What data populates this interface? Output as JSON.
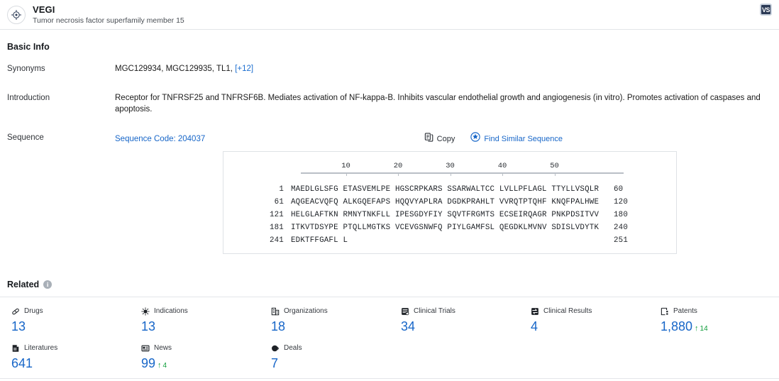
{
  "header": {
    "title": "VEGI",
    "subtitle": "Tumor necrosis factor superfamily member 15",
    "badge_label": "VS",
    "target_icon": "target-icon"
  },
  "basic_info": {
    "section_title": "Basic Info",
    "synonyms": {
      "label": "Synonyms",
      "value": "MGC129934, MGC129935, TL1,",
      "more": "[+12]"
    },
    "introduction": {
      "label": "Introduction",
      "value": "Receptor for TNFRSF25 and TNFRSF6B. Mediates activation of NF-kappa-B. Inhibits vascular endothelial growth and angiogenesis (in vitro). Promotes activation of caspases and apoptosis."
    },
    "sequence": {
      "label": "Sequence",
      "code_label": "Sequence Code: 204037",
      "copy_label": "Copy",
      "find_similar_label": "Find Similar Sequence",
      "ruler_ticks": [
        "10",
        "20",
        "30",
        "40",
        "50"
      ],
      "rows": [
        {
          "start": "1",
          "chunks": "MAEDLGLSFG ETASVEMLPE HGSCRPKARS SSARWALTCC LVLLPFLAGL TTYLLVSQLR",
          "end": "60"
        },
        {
          "start": "61",
          "chunks": "AQGEACVQFQ ALKGQEFAPS HQQVYAPLRA DGDKPRAHLT VVRQTPTQHF KNQFPALHWE",
          "end": "120"
        },
        {
          "start": "121",
          "chunks": "HELGLAFTKN RMNYTNKFLL IPESGDYFIY SQVTFRGMTS ECSEIRQAGR PNKPDSITVV",
          "end": "180"
        },
        {
          "start": "181",
          "chunks": "ITKVTDSYPE PTQLLMGTKS VCEVGSNWFQ PIYLGAMFSL QEGDKLMVNV SDISLVDYTK",
          "end": "240"
        },
        {
          "start": "241",
          "chunks": "EDKTFFGAFL L",
          "end": "251"
        }
      ]
    }
  },
  "related": {
    "title": "Related",
    "info_icon": "info-icon",
    "stats": [
      {
        "label": "Drugs",
        "icon": "pill-icon",
        "value": "13"
      },
      {
        "label": "Indications",
        "icon": "virus-icon",
        "value": "13"
      },
      {
        "label": "Organizations",
        "icon": "building-icon",
        "value": "18"
      },
      {
        "label": "Clinical Trials",
        "icon": "clinical-trial-icon",
        "value": "34"
      },
      {
        "label": "Clinical Results",
        "icon": "clinical-result-icon",
        "value": "4"
      },
      {
        "label": "Patents",
        "icon": "patent-icon",
        "value": "1,880",
        "delta": "14",
        "delta_dir": "up"
      },
      {
        "label": "Literatures",
        "icon": "book-icon",
        "value": "641"
      },
      {
        "label": "News",
        "icon": "news-icon",
        "value": "99",
        "delta": "4",
        "delta_dir": "up"
      },
      {
        "label": "Deals",
        "icon": "deal-icon",
        "value": "7"
      }
    ]
  },
  "colors": {
    "accent_blue": "#1766c8",
    "delta_green": "#0f9d3a",
    "badge_dark": "#2b3a55"
  }
}
